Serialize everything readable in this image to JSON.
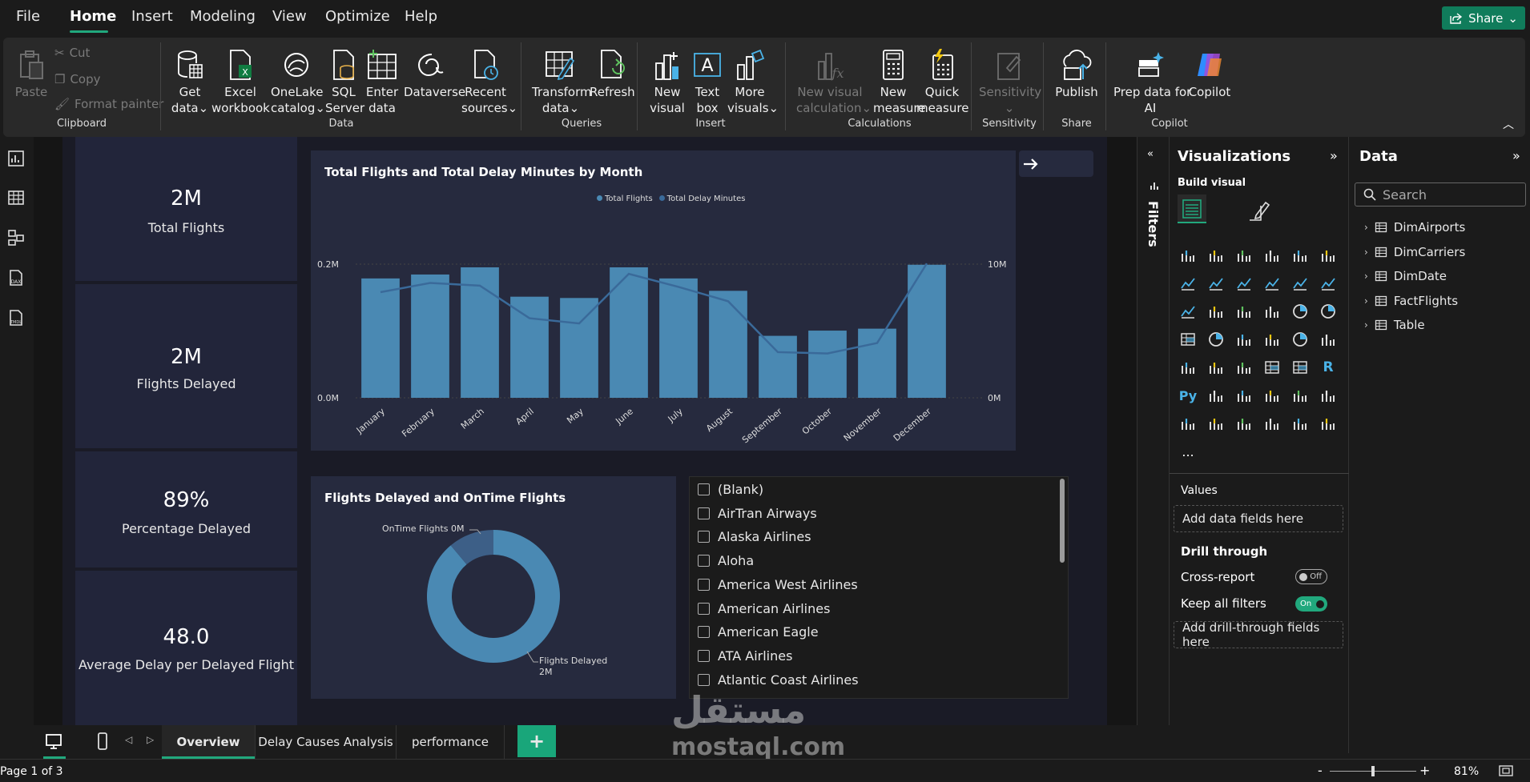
{
  "menu": {
    "items": [
      "File",
      "Home",
      "Insert",
      "Modeling",
      "View",
      "Optimize",
      "Help"
    ],
    "share_label": "Share"
  },
  "ribbon": {
    "clipboard": {
      "paste": "Paste",
      "cut": "Cut",
      "copy": "Copy",
      "format_painter": "Format painter",
      "group": "Clipboard"
    },
    "data": {
      "get_data": [
        "Get",
        "data"
      ],
      "excel": [
        "Excel",
        "workbook"
      ],
      "onelake": [
        "OneLake",
        "catalog"
      ],
      "sql": [
        "SQL",
        "Server"
      ],
      "enter": [
        "Enter",
        "data"
      ],
      "dataverse": "Dataverse",
      "recent": [
        "Recent",
        "sources"
      ],
      "group": "Data"
    },
    "queries": {
      "transform": [
        "Transform",
        "data"
      ],
      "refresh": "Refresh",
      "group": "Queries"
    },
    "insert": {
      "new_visual": [
        "New",
        "visual"
      ],
      "text_box": [
        "Text",
        "box"
      ],
      "more_visuals": [
        "More",
        "visuals"
      ],
      "group": "Insert"
    },
    "calculations": {
      "new_visual_calc": [
        "New visual",
        "calculation"
      ],
      "new_measure": [
        "New",
        "measure"
      ],
      "quick_measure": [
        "Quick",
        "measure"
      ],
      "group": "Calculations"
    },
    "sensitivity": {
      "label": "Sensitivity",
      "group": "Sensitivity"
    },
    "share": {
      "publish": "Publish",
      "group": "Share"
    },
    "copilot": {
      "prep": [
        "Prep data for",
        "AI"
      ],
      "copilot": "Copilot",
      "group": "Copilot"
    }
  },
  "kpis": [
    {
      "value": "2M",
      "label": "Total Flights"
    },
    {
      "value": "2M",
      "label": "Flights Delayed"
    },
    {
      "value": "89%",
      "label": "Percentage Delayed"
    },
    {
      "value": "48.0",
      "label": "Average Delay per Delayed Flight"
    }
  ],
  "chart_data": [
    {
      "type": "bar",
      "title": "Total Flights and Total Delay Minutes by Month",
      "categories": [
        "January",
        "February",
        "March",
        "April",
        "May",
        "June",
        "July",
        "August",
        "September",
        "October",
        "November",
        "December"
      ],
      "series": [
        {
          "name": "Total Flights",
          "type": "bar",
          "axis": "left",
          "values": [
            0.183,
            0.189,
            0.2,
            0.155,
            0.153,
            0.2,
            0.183,
            0.164,
            0.095,
            0.103,
            0.106,
            0.204
          ]
        },
        {
          "name": "Total Delay Minutes",
          "type": "line",
          "axis": "right",
          "values": [
            8.1,
            8.8,
            8.6,
            6.1,
            5.7,
            9.5,
            8.5,
            7.4,
            3.5,
            3.4,
            4.2,
            10.3
          ]
        }
      ],
      "y_left": {
        "ticks": [
          "0.0M",
          "0.2M"
        ],
        "range": [
          0,
          0.2
        ]
      },
      "y_right": {
        "ticks": [
          "0M",
          "10M"
        ],
        "range": [
          0,
          10
        ]
      },
      "legend": "top-center",
      "colors": {
        "bar": "#4a89b3",
        "line": "#3a6a9a"
      }
    },
    {
      "type": "pie",
      "title": "Flights Delayed and OnTime Flights",
      "donut": true,
      "slices": [
        {
          "name": "Flights Delayed",
          "value": 2,
          "label": "Flights Delayed 2M",
          "color": "#4a89b3"
        },
        {
          "name": "OnTime Flights",
          "value": 0.25,
          "label": "OnTime Flights 0M",
          "color": "#3d5f87"
        }
      ]
    }
  ],
  "legend_labels": {
    "total_flights": "Total Flights",
    "delay_minutes": "Total Delay Minutes"
  },
  "donut_labels": {
    "ontime": "OnTime Flights 0M",
    "delayed_1": "Flights Delayed",
    "delayed_2": "2M"
  },
  "slicer": {
    "items": [
      "(Blank)",
      "AirTran Airways",
      "Alaska Airlines",
      "Aloha",
      "America West Airlines",
      "American Airlines",
      "American Eagle",
      "ATA Airlines",
      "Atlantic Coast Airlines"
    ]
  },
  "filters": {
    "label": "Filters"
  },
  "visualizations": {
    "title": "Visualizations",
    "build_visual": "Build visual",
    "values_label": "Values",
    "add_fields": "Add data fields here",
    "drill_through": "Drill through",
    "cross_report": "Cross-report",
    "cross_report_state": "Off",
    "keep_filters": "Keep all filters",
    "keep_filters_state": "On",
    "add_drill": "Add drill-through fields here",
    "more": "..."
  },
  "data_pane": {
    "title": "Data",
    "search_placeholder": "Search",
    "tables": [
      "DimAirports",
      "DimCarriers",
      "DimDate",
      "FactFlights",
      "Table"
    ]
  },
  "tabs": {
    "pages": [
      "Overview",
      "Delay Causes Analysis",
      "performance"
    ],
    "add": "+"
  },
  "status": {
    "page": "Page 1 of 3",
    "zoom": "81%",
    "zoom_level": 0.5,
    "minus": "-",
    "plus": "+"
  },
  "watermark": {
    "arabic": "مستقل",
    "latin": "mostaql.com"
  }
}
